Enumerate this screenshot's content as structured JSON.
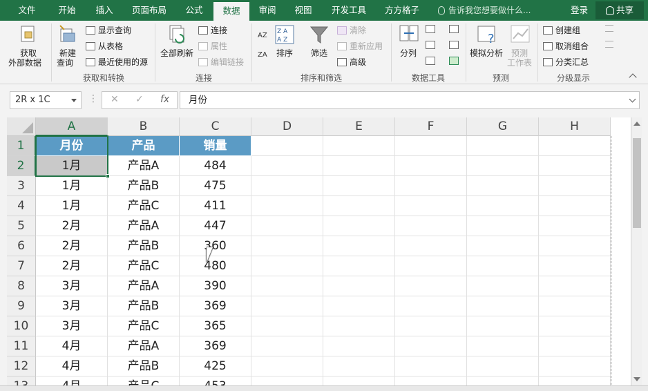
{
  "tabs": [
    {
      "label": "文件"
    },
    {
      "label": "开始"
    },
    {
      "label": "插入"
    },
    {
      "label": "页面布局"
    },
    {
      "label": "公式"
    },
    {
      "label": "数据"
    },
    {
      "label": "审阅"
    },
    {
      "label": "视图"
    },
    {
      "label": "开发工具"
    },
    {
      "label": "方方格子"
    }
  ],
  "active_tab": "数据",
  "tell_me": "告诉我您想要做什么...",
  "login": "登录",
  "share": "共享",
  "ribbon": {
    "get_external_1": "获取",
    "get_external_2": "外部数据",
    "new_query_1": "新建",
    "new_query_2": "查询",
    "show_query": "显示查询",
    "from_table": "从表格",
    "recent_sources": "最近使用的源",
    "group_get_transform": "获取和转换",
    "refresh_all": "全部刷新",
    "connections": "连接",
    "properties": "属性",
    "edit_links": "编辑链接",
    "group_connections": "连接",
    "sort": "排序",
    "filter": "筛选",
    "clear": "清除",
    "reapply": "重新应用",
    "advanced": "高级",
    "group_sort_filter": "排序和筛选",
    "text_to_columns": "分列",
    "group_data_tools": "数据工具",
    "what_if_1": "模拟分析",
    "forecast_1": "预测",
    "forecast_2": "工作表",
    "group_forecast": "预测",
    "group_create": "创建组",
    "ungroup": "取消组合",
    "subtotal": "分类汇总",
    "group_outline": "分级显示"
  },
  "formula_bar": {
    "name_box": "2R x 1C",
    "cancel": "✕",
    "enter": "✓",
    "fx": "fx",
    "content": "月份"
  },
  "columns": [
    "A",
    "B",
    "C",
    "D",
    "E",
    "F",
    "G",
    "H"
  ],
  "rows": [
    {
      "num": "1",
      "a": "月份",
      "b": "产品",
      "c": "销量"
    },
    {
      "num": "2",
      "a": "1月",
      "b": "产品A",
      "c": "484"
    },
    {
      "num": "3",
      "a": "1月",
      "b": "产品B",
      "c": "475"
    },
    {
      "num": "4",
      "a": "1月",
      "b": "产品C",
      "c": "411"
    },
    {
      "num": "5",
      "a": "2月",
      "b": "产品A",
      "c": "447"
    },
    {
      "num": "6",
      "a": "2月",
      "b": "产品B",
      "c": "360"
    },
    {
      "num": "7",
      "a": "2月",
      "b": "产品C",
      "c": "480"
    },
    {
      "num": "8",
      "a": "3月",
      "b": "产品A",
      "c": "390"
    },
    {
      "num": "9",
      "a": "3月",
      "b": "产品B",
      "c": "369"
    },
    {
      "num": "10",
      "a": "3月",
      "b": "产品C",
      "c": "365"
    },
    {
      "num": "11",
      "a": "4月",
      "b": "产品A",
      "c": "369"
    },
    {
      "num": "12",
      "a": "4月",
      "b": "产品B",
      "c": "425"
    },
    {
      "num": "13",
      "a": "4月",
      "b": "产品C",
      "c": "453"
    }
  ],
  "colors": {
    "accent": "#217346",
    "header_fill": "#5b9bc5"
  }
}
